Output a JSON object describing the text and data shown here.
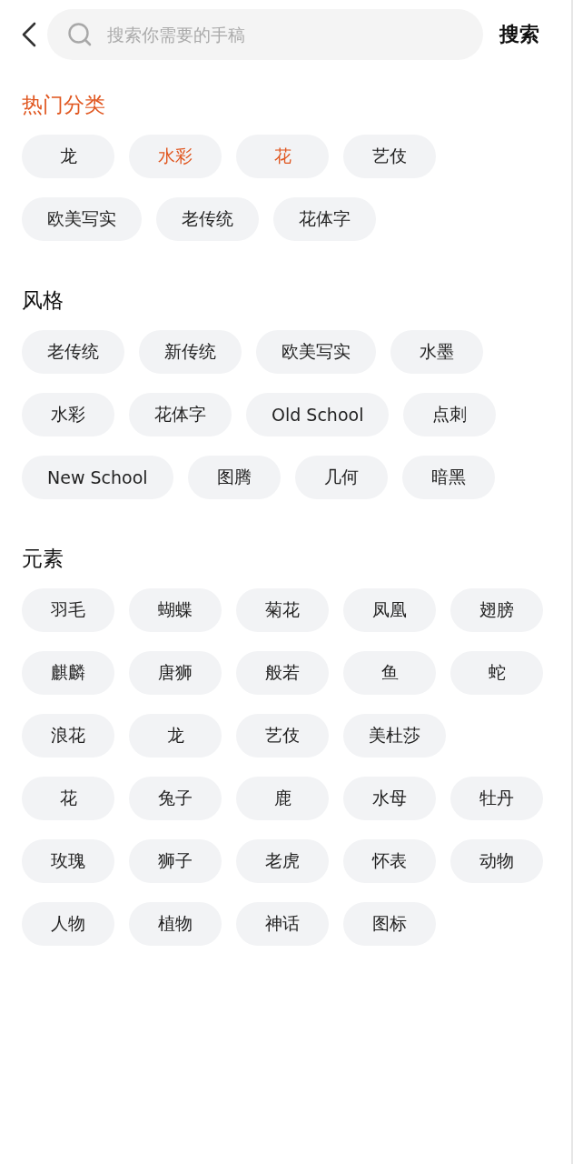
{
  "search": {
    "placeholder": "搜索你需要的手稿",
    "button": "搜索"
  },
  "sections": [
    {
      "title": "热门分类",
      "highlighted": true,
      "tags": [
        {
          "label": "龙",
          "highlighted": false
        },
        {
          "label": "水彩",
          "highlighted": true
        },
        {
          "label": "花",
          "highlighted": true
        },
        {
          "label": "艺伎",
          "highlighted": false
        },
        {
          "label": "欧美写实",
          "highlighted": false
        },
        {
          "label": "老传统",
          "highlighted": false
        },
        {
          "label": "花体字",
          "highlighted": false
        }
      ]
    },
    {
      "title": "风格",
      "highlighted": false,
      "tags": [
        {
          "label": "老传统",
          "highlighted": false
        },
        {
          "label": "新传统",
          "highlighted": false
        },
        {
          "label": "欧美写实",
          "highlighted": false
        },
        {
          "label": "水墨",
          "highlighted": false
        },
        {
          "label": "水彩",
          "highlighted": false
        },
        {
          "label": "花体字",
          "highlighted": false
        },
        {
          "label": "Old School",
          "highlighted": false
        },
        {
          "label": "点刺",
          "highlighted": false
        },
        {
          "label": "New School",
          "highlighted": false
        },
        {
          "label": "图腾",
          "highlighted": false
        },
        {
          "label": "几何",
          "highlighted": false
        },
        {
          "label": "暗黑",
          "highlighted": false
        }
      ]
    },
    {
      "title": "元素",
      "highlighted": false,
      "tags": [
        {
          "label": "羽毛",
          "highlighted": false
        },
        {
          "label": "蝴蝶",
          "highlighted": false
        },
        {
          "label": "菊花",
          "highlighted": false
        },
        {
          "label": "凤凰",
          "highlighted": false
        },
        {
          "label": "翅膀",
          "highlighted": false
        },
        {
          "label": "麒麟",
          "highlighted": false
        },
        {
          "label": "唐狮",
          "highlighted": false
        },
        {
          "label": "般若",
          "highlighted": false
        },
        {
          "label": "鱼",
          "highlighted": false
        },
        {
          "label": "蛇",
          "highlighted": false
        },
        {
          "label": "浪花",
          "highlighted": false
        },
        {
          "label": "龙",
          "highlighted": false
        },
        {
          "label": "艺伎",
          "highlighted": false
        },
        {
          "label": "美杜莎",
          "highlighted": false
        },
        {
          "label": "花",
          "highlighted": false
        },
        {
          "label": "兔子",
          "highlighted": false
        },
        {
          "label": "鹿",
          "highlighted": false
        },
        {
          "label": "水母",
          "highlighted": false
        },
        {
          "label": "牡丹",
          "highlighted": false
        },
        {
          "label": "玫瑰",
          "highlighted": false
        },
        {
          "label": "狮子",
          "highlighted": false
        },
        {
          "label": "老虎",
          "highlighted": false
        },
        {
          "label": "怀表",
          "highlighted": false
        },
        {
          "label": "动物",
          "highlighted": false
        },
        {
          "label": "人物",
          "highlighted": false
        },
        {
          "label": "植物",
          "highlighted": false
        },
        {
          "label": "神话",
          "highlighted": false
        },
        {
          "label": "图标",
          "highlighted": false
        }
      ]
    }
  ]
}
